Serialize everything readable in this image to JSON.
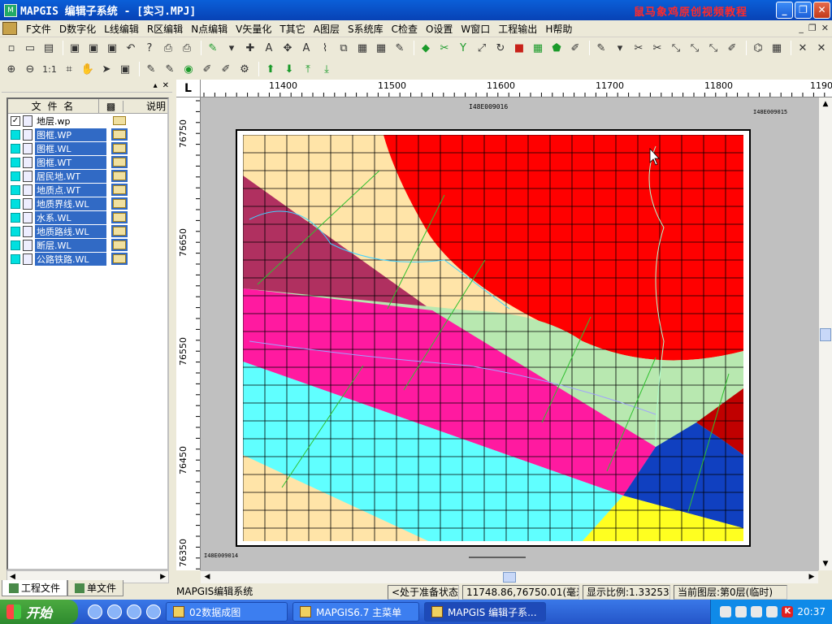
{
  "window": {
    "title": "MAPGIS 编辑子系统 - [实习.MPJ]",
    "watermark": "鼠马象鸡原创视频教程",
    "minimize": "_",
    "restore": "❐",
    "close": "✕"
  },
  "menu": [
    "F文件",
    "D数字化",
    "L线编辑",
    "R区编辑",
    "N点编辑",
    "V矢量化",
    "T其它",
    "A图层",
    "S系统库",
    "C检查",
    "O设置",
    "W窗口",
    "工程输出",
    "H帮助"
  ],
  "leftpanel": {
    "header": {
      "name": "文 件 名",
      "desc": "说明"
    },
    "files": [
      {
        "name": "地层.wp",
        "checked": true,
        "selected": false
      },
      {
        "name": "图框.WP",
        "checked": false,
        "selected": true
      },
      {
        "name": "图框.WL",
        "checked": false,
        "selected": true
      },
      {
        "name": "图框.WT",
        "checked": false,
        "selected": true
      },
      {
        "name": "居民地.WT",
        "checked": false,
        "selected": true
      },
      {
        "name": "地质点.WT",
        "checked": false,
        "selected": true
      },
      {
        "name": "地质界线.WL",
        "checked": false,
        "selected": true
      },
      {
        "name": "水系.WL",
        "checked": false,
        "selected": true
      },
      {
        "name": "地质路线.WL",
        "checked": false,
        "selected": true
      },
      {
        "name": "断层.WL",
        "checked": false,
        "selected": true
      },
      {
        "name": "公路铁路.WL",
        "checked": false,
        "selected": true
      }
    ],
    "tabs": {
      "project": "工程文件",
      "single": "单文件"
    }
  },
  "ruler": {
    "corner": "L",
    "x_labels": [
      "11400",
      "11500",
      "11600",
      "11700",
      "11800",
      "1190"
    ],
    "y_labels": [
      "76750",
      "76650",
      "76550",
      "76450",
      "76350"
    ]
  },
  "map": {
    "header_left": "I48E009016",
    "header_right": "I48E009015",
    "footer_left": "I48E009014",
    "colors": {
      "cream": "#ffe4a8",
      "red": "#ff0000",
      "maroon": "#b03060",
      "magenta": "#ff1aa0",
      "lightgreen": "#b8e8b0",
      "cyan": "#60ffff",
      "blue": "#1040c0",
      "yellow": "#ffff20",
      "darkred": "#c00000"
    }
  },
  "status": {
    "app": "MAPGIS编辑系统",
    "state": "<处于准备状态>",
    "coords": "11748.86,76750.01(毫米)",
    "scale": "显示比例:1.332535",
    "layer": "当前图层:第0层(临时)"
  },
  "taskbar": {
    "start": "开始",
    "tasks": [
      {
        "label": "02数据成图",
        "active": false
      },
      {
        "label": "MAPGIS6.7 主菜单",
        "active": false
      },
      {
        "label": "MAPGIS 编辑子系...",
        "active": true
      }
    ],
    "clock": "20:37"
  }
}
